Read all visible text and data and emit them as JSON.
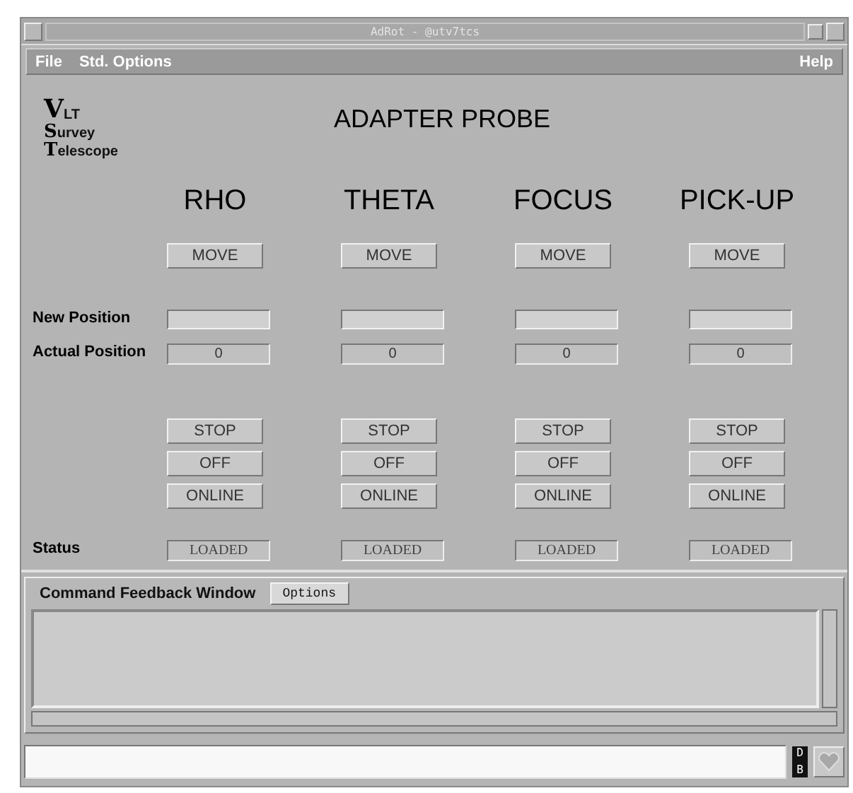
{
  "window": {
    "title": "AdRot - @utv7tcs"
  },
  "menu": {
    "left": [
      "File",
      "Std. Options"
    ],
    "right": [
      "Help"
    ]
  },
  "logo": {
    "parts": [
      {
        "kind": "big",
        "text": "V"
      },
      {
        "kind": "small",
        "text": "LT"
      },
      {
        "kind": "big",
        "text": "S"
      },
      {
        "kind": "small",
        "text": "urvey"
      },
      {
        "kind": "big",
        "text": "T"
      },
      {
        "kind": "small",
        "text": "elescope"
      }
    ]
  },
  "title": "ADAPTER PROBE",
  "row_labels": {
    "new_position": "New Position",
    "actual_position": "Actual Position",
    "status": "Status"
  },
  "axes": [
    {
      "name": "RHO",
      "move": "MOVE",
      "actual": "0",
      "buttons": [
        "STOP",
        "OFF",
        "ONLINE"
      ],
      "status": "LOADED"
    },
    {
      "name": "THETA",
      "move": "MOVE",
      "actual": "0",
      "buttons": [
        "STOP",
        "OFF",
        "ONLINE"
      ],
      "status": "LOADED"
    },
    {
      "name": "FOCUS",
      "move": "MOVE",
      "actual": "0",
      "buttons": [
        "STOP",
        "OFF",
        "ONLINE"
      ],
      "status": "LOADED"
    },
    {
      "name": "PICK-UP",
      "move": "MOVE",
      "actual": "0",
      "buttons": [
        "STOP",
        "OFF",
        "ONLINE"
      ],
      "status": "LOADED"
    }
  ],
  "feedback": {
    "title": "Command Feedback Window",
    "options_button": "Options"
  },
  "db_badge": {
    "top": "D",
    "bottom": "B"
  }
}
